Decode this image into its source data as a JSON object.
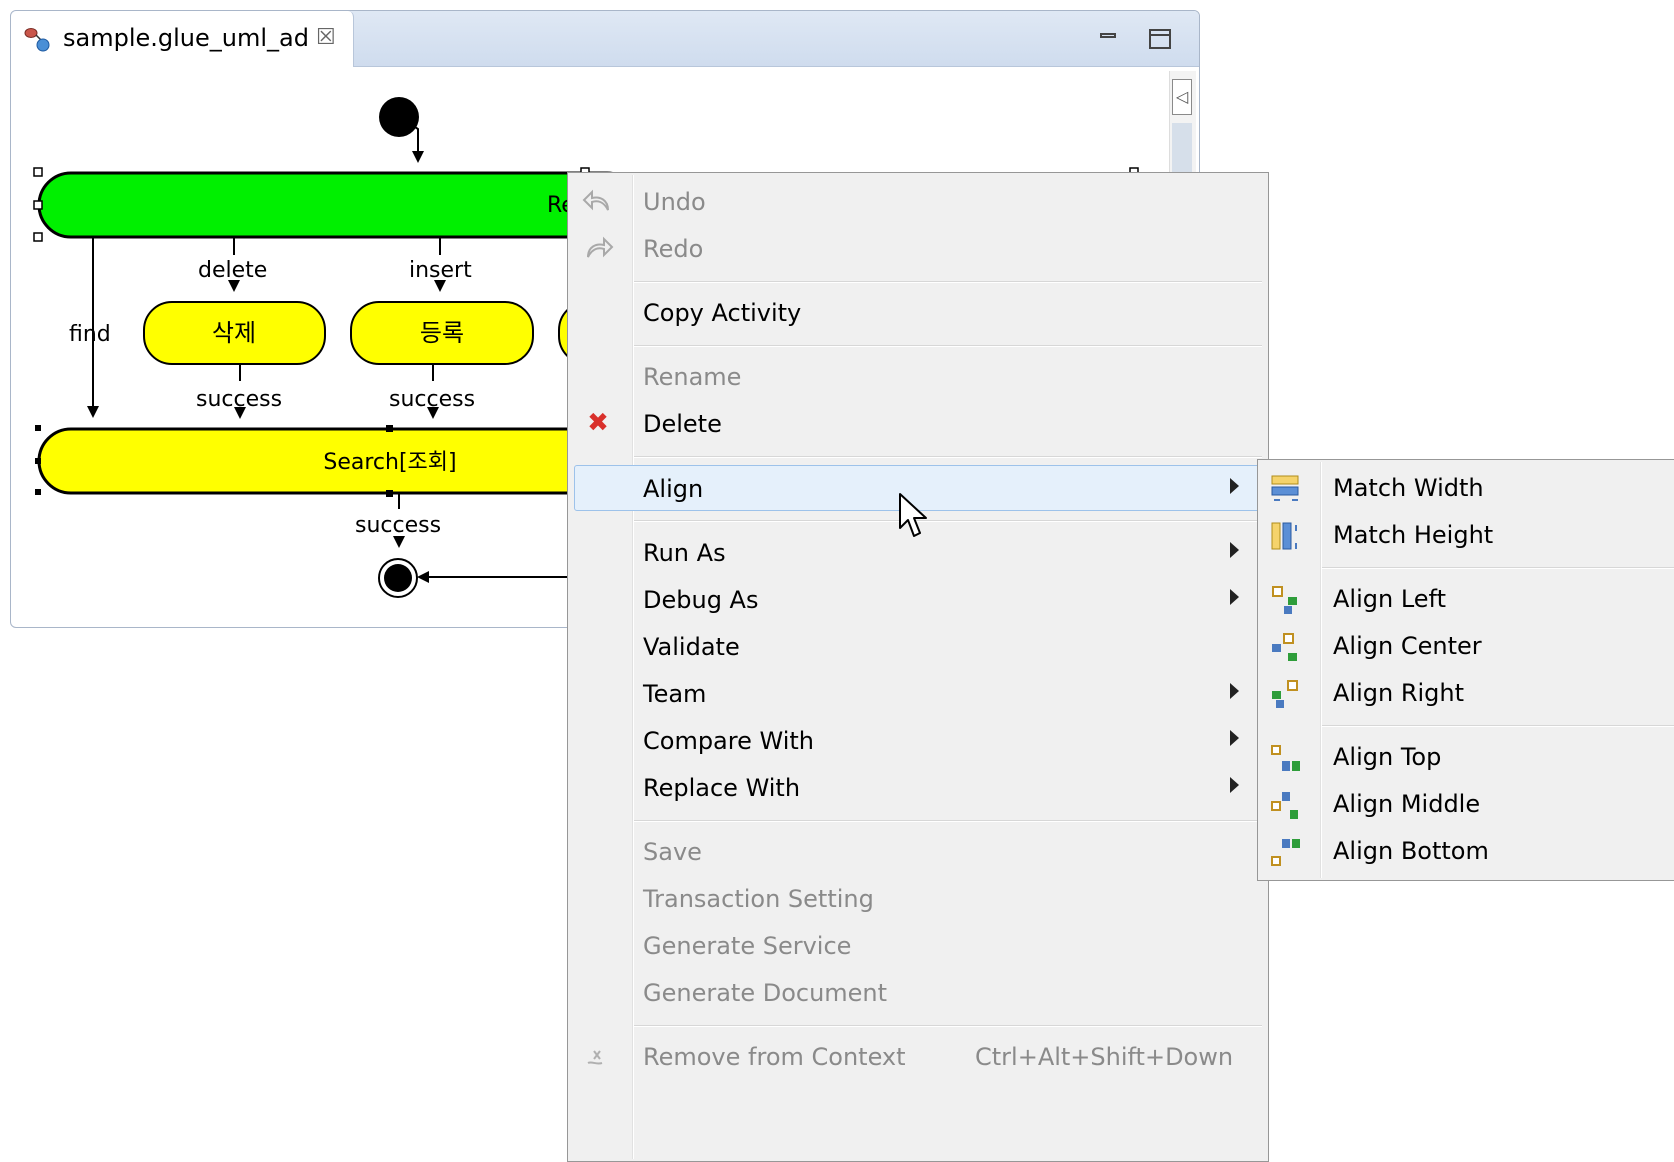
{
  "editor": {
    "tab_title": "sample.glue_uml_ad",
    "tab_close": "☒"
  },
  "diagram": {
    "top_activity_label": "Re",
    "flows": [
      "delete",
      "insert",
      "find"
    ],
    "activities": [
      "삭제",
      "등록"
    ],
    "success_labels": [
      "success",
      "success",
      "success"
    ],
    "search_activity_label": "Search[조회]"
  },
  "context_menu": {
    "items": [
      {
        "label": "Undo",
        "enabled": false,
        "icon": "undo-icon"
      },
      {
        "label": "Redo",
        "enabled": false,
        "icon": "redo-icon"
      },
      {
        "label": "Copy Activity",
        "enabled": true
      },
      {
        "label": "Rename",
        "enabled": false
      },
      {
        "label": "Delete",
        "enabled": true,
        "icon": "delete-icon",
        "icon_color": "#d9302b"
      },
      {
        "label": "Align",
        "enabled": true,
        "submenu": true,
        "highlighted": true
      },
      {
        "label": "Run As",
        "enabled": true,
        "submenu": true
      },
      {
        "label": "Debug As",
        "enabled": true,
        "submenu": true
      },
      {
        "label": "Validate",
        "enabled": true
      },
      {
        "label": "Team",
        "enabled": true,
        "submenu": true
      },
      {
        "label": "Compare With",
        "enabled": true,
        "submenu": true
      },
      {
        "label": "Replace With",
        "enabled": true,
        "submenu": true
      },
      {
        "label": "Save",
        "enabled": false
      },
      {
        "label": "Transaction Setting",
        "enabled": false
      },
      {
        "label": "Generate Service",
        "enabled": false
      },
      {
        "label": "Generate Document",
        "enabled": false
      },
      {
        "label": "Remove from Context",
        "enabled": false,
        "accelerator": "Ctrl+Alt+Shift+Down",
        "icon": "remove-context-icon"
      }
    ]
  },
  "align_submenu": {
    "items": [
      {
        "label": "Match Width",
        "icon": "match-width-icon"
      },
      {
        "label": "Match Height",
        "icon": "match-height-icon"
      },
      {
        "label": "Align Left",
        "icon": "align-left-icon"
      },
      {
        "label": "Align Center",
        "icon": "align-center-icon"
      },
      {
        "label": "Align Right",
        "icon": "align-right-icon"
      },
      {
        "label": "Align Top",
        "icon": "align-top-icon"
      },
      {
        "label": "Align Middle",
        "icon": "align-middle-icon"
      },
      {
        "label": "Align Bottom",
        "icon": "align-bottom-icon"
      }
    ]
  },
  "colors": {
    "activity_green": "#00f000",
    "activity_yellow": "#ffff00",
    "menu_bg": "#f0f0f0",
    "highlight": "#e5f0fb"
  }
}
